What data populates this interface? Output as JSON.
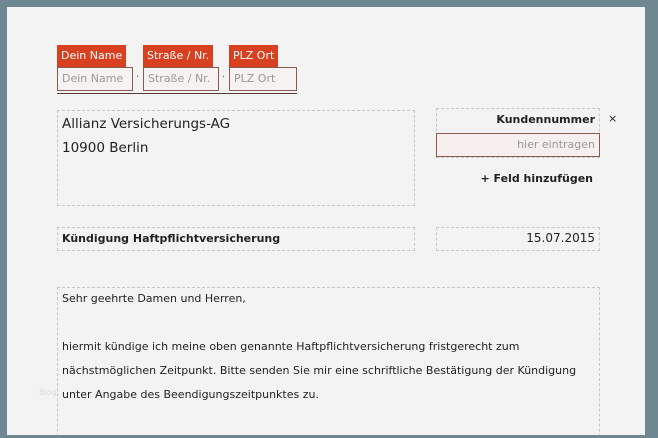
{
  "sender": {
    "fields": [
      {
        "label": "Dein Name",
        "placeholder": "Dein Name"
      },
      {
        "label": "Straße / Nr.",
        "placeholder": "Straße / Nr."
      },
      {
        "label": "PLZ Ort",
        "placeholder": "PLZ Ort"
      }
    ],
    "separator": "·"
  },
  "recipient": {
    "line1": "Allianz Versicherungs-AG",
    "line2": "10900 Berlin"
  },
  "customer_number": {
    "label": "Kundennummer",
    "placeholder": "hier eintragen",
    "remove": "×",
    "add_field": "+ Feld hinzufügen"
  },
  "subject": "Kündigung Haftpflichtversicherung",
  "date": "15.07.2015",
  "body": {
    "greeting": "Sehr geehrte Damen und Herren,",
    "lines": [
      "hiermit kündige ich meine oben genannte Haftpflichtversicherung fristgerecht zum",
      "nächstmöglichen Zeitpunkt. Bitte senden Sie mir eine schriftliche Bestätigung der Kündigung",
      "unter Angabe des Beendigungszeitpunktes zu."
    ]
  },
  "watermark": "Blog"
}
